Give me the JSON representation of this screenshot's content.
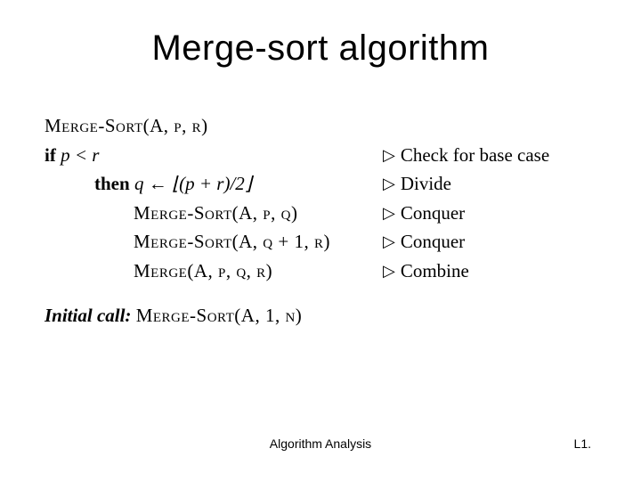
{
  "title": "Merge-sort algorithm",
  "proc_signature": "Merge-Sort(A, p, r)",
  "if_kw": "if",
  "if_cond": " p < r",
  "then_kw": "then",
  "assign": " q ← ⌊(p + r)/2⌋",
  "call1": "Merge-Sort(A, p, q)",
  "call2": "Merge-Sort(A, q + 1, r)",
  "call3": "Merge(A, p, q, r)",
  "comments": {
    "c1": "Check for base case",
    "c2": "Divide",
    "c3": "Conquer",
    "c4": "Conquer",
    "c5": "Combine"
  },
  "tri": "▷",
  "initial_label": "Initial call:",
  "initial_call": "Merge-Sort(A, 1, n)",
  "footer_center": "Algorithm Analysis",
  "footer_right": "L1."
}
